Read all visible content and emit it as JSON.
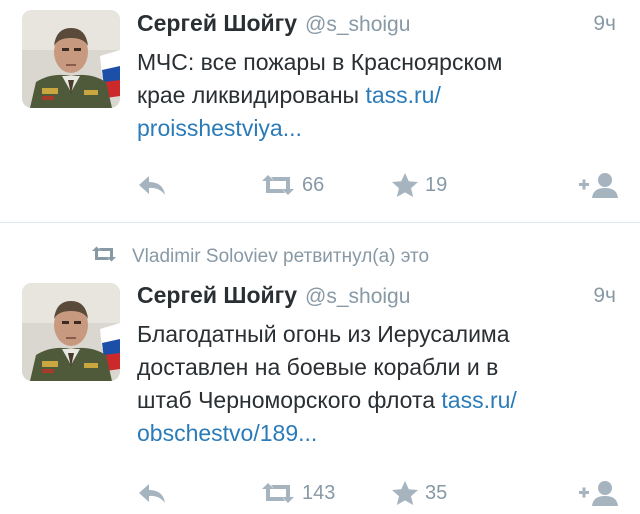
{
  "tweets": [
    {
      "author": "Сергей Шойгу",
      "handle": "@s_shoigu",
      "time": "9ч",
      "text_lines": [
        "МЧС: все пожары в Красноярском",
        "крае ликвидированы "
      ],
      "link_part1": "tass.ru/",
      "link_part2": "proisshestviya...",
      "retweets": "66",
      "favorites": "19"
    },
    {
      "retweeted_by": "Vladimir Soloviev ретвитнул(а) это",
      "author": "Сергей Шойгу",
      "handle": "@s_shoigu",
      "time": "9ч",
      "text_lines": [
        "Благодатный огонь из Иерусалима",
        "доставлен на боевые корабли и в",
        "штаб Черноморского флота "
      ],
      "link_part1": "tass.ru/",
      "link_part2": "obschestvo/189...",
      "retweets": "143",
      "favorites": "35"
    }
  ],
  "icons": {
    "reply": "reply-icon",
    "retweet": "retweet-icon",
    "favorite": "star-icon",
    "follow": "follow-icon"
  },
  "colors": {
    "link": "#2b7bb9",
    "muted": "#8899a6",
    "icon": "#a6b4bf",
    "text": "#292f33"
  }
}
